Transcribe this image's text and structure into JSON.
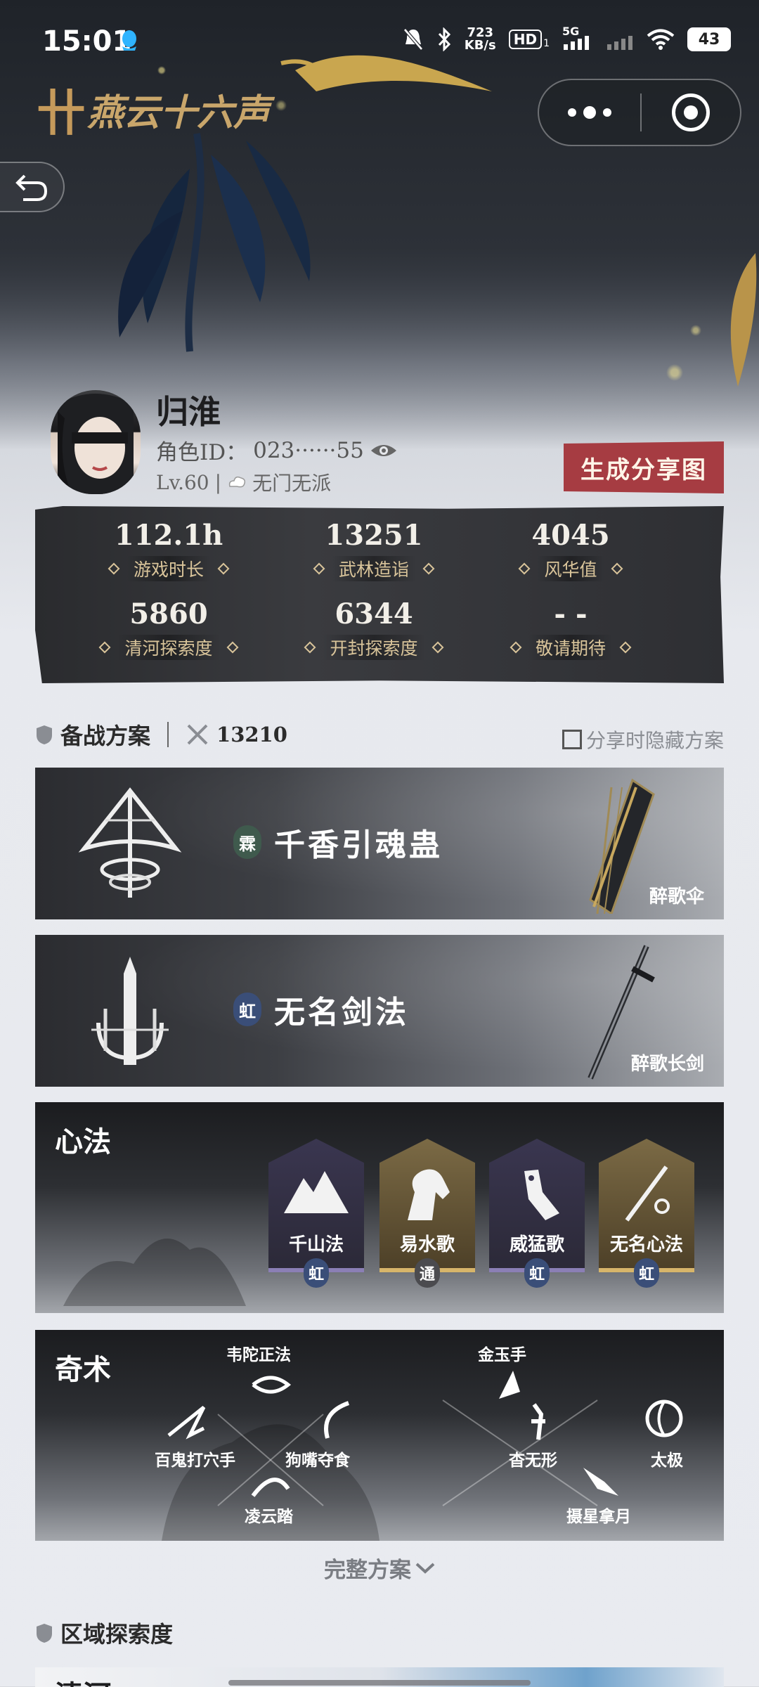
{
  "status_bar": {
    "time": "15:01",
    "net_speed_value": "723",
    "net_speed_unit": "KB/s",
    "hd": "HD",
    "hd_sub": "1",
    "signal_label": "5G",
    "battery": "43"
  },
  "app": {
    "logo_text": "燕云十六声"
  },
  "profile": {
    "name": "归淮",
    "role_id_label": "角色ID：",
    "role_id": "023······55",
    "level": "Lv.60",
    "level_sep": "|",
    "sect": "无门无派",
    "share_button": "生成分享图"
  },
  "stats": [
    {
      "value": "112.1h",
      "label": "游戏时长"
    },
    {
      "value": "13251",
      "label": "武林造诣"
    },
    {
      "value": "4045",
      "label": "风华值"
    },
    {
      "value": "5860",
      "label": "清河探索度"
    },
    {
      "value": "6344",
      "label": "开封探索度"
    },
    {
      "value": "- -",
      "label": "敬请期待"
    }
  ],
  "loadout": {
    "title": "备战方案",
    "power": "13210",
    "hide_option": "分享时隐藏方案",
    "hide_checked": false,
    "weapons": [
      {
        "badge": "霖",
        "title": "千香引魂蛊",
        "weapon_name": "醉歌伞",
        "badge_color": "#3f5a4d"
      },
      {
        "badge": "虹",
        "title": "无名剑法",
        "weapon_name": "醉歌长剑",
        "badge_color": "#3a4e78"
      }
    ]
  },
  "xinfa": {
    "title": "心法",
    "items": [
      {
        "name": "千山法",
        "badge": "虹",
        "tone": "purple"
      },
      {
        "name": "易水歌",
        "badge": "通",
        "tone": "gold"
      },
      {
        "name": "威猛歌",
        "badge": "虹",
        "tone": "purple"
      },
      {
        "name": "无名心法",
        "badge": "虹",
        "tone": "gold"
      }
    ]
  },
  "qishu": {
    "title": "奇术",
    "left": [
      "韦陀正法",
      "百鬼打穴手",
      "狗嘴夺食",
      "凌云踏"
    ],
    "right": [
      "金玉手",
      "杳无形",
      "太极",
      "摄星拿月"
    ]
  },
  "full_plan_label": "完整方案",
  "region": {
    "title": "区域探索度",
    "first_card_title": "清河"
  }
}
